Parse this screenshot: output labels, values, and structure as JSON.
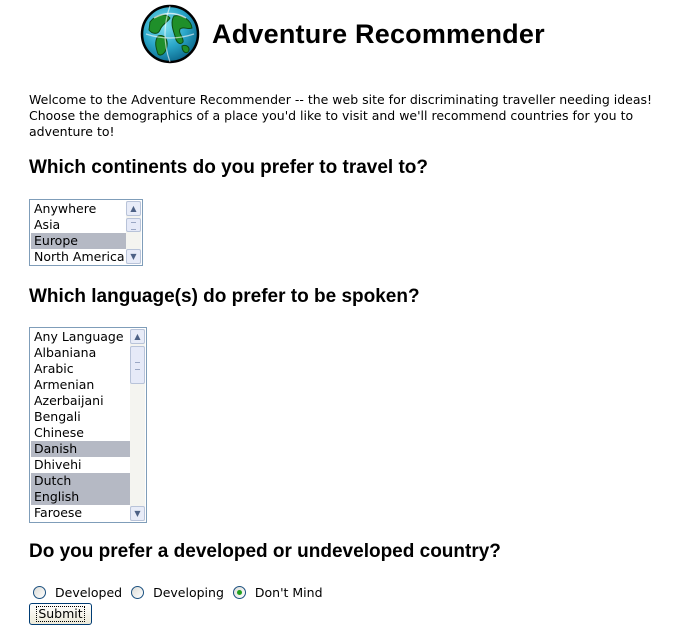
{
  "header": {
    "logo_icon": "globe-icon",
    "title": "Adventure Recommender"
  },
  "intro": {
    "text": "Welcome to the Adventure Recommender -- the web site for discriminating traveller needing ideas! Choose the demographics of a place you'd like to visit and we'll recommend countries for you to adventure to!"
  },
  "questions": {
    "continents": "Which continents do you prefer to travel to?",
    "languages": "Which language(s) do prefer to be spoken?",
    "development": "Do you prefer a developed or undeveloped country?"
  },
  "continents_list": {
    "options": [
      {
        "label": "Anywhere",
        "selected": false
      },
      {
        "label": "Asia",
        "selected": false
      },
      {
        "label": "Europe",
        "selected": true
      },
      {
        "label": "North America",
        "selected": false
      }
    ]
  },
  "languages_list": {
    "options": [
      {
        "label": "Any Language",
        "selected": false
      },
      {
        "label": "Albaniana",
        "selected": false
      },
      {
        "label": "Arabic",
        "selected": false
      },
      {
        "label": "Armenian",
        "selected": false
      },
      {
        "label": "Azerbaijani",
        "selected": false
      },
      {
        "label": "Bengali",
        "selected": false
      },
      {
        "label": "Chinese",
        "selected": false
      },
      {
        "label": "Danish",
        "selected": true
      },
      {
        "label": "Dhivehi",
        "selected": false
      },
      {
        "label": "Dutch",
        "selected": true
      },
      {
        "label": "English",
        "selected": true
      },
      {
        "label": "Faroese",
        "selected": false
      }
    ]
  },
  "development": {
    "options": [
      {
        "label": "Developed",
        "checked": false
      },
      {
        "label": "Developing",
        "checked": false
      },
      {
        "label": "Don't Mind",
        "checked": true
      }
    ]
  },
  "submit": {
    "label": "Submit"
  },
  "colors": {
    "selection": "#b5b9c4",
    "listbox_border": "#7f9db9",
    "radio_checked": "#21a121",
    "button_border": "#003c74"
  }
}
